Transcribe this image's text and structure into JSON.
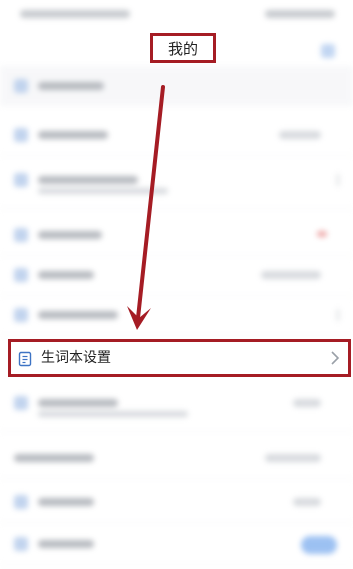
{
  "header": {
    "title": "我的"
  },
  "highlighted_item": {
    "label": "生词本设置",
    "icon": "notebook-icon",
    "chevron": "chevron-right-icon"
  },
  "colors": {
    "highlight": "#a51c24",
    "accent": "#4d8fe8"
  }
}
